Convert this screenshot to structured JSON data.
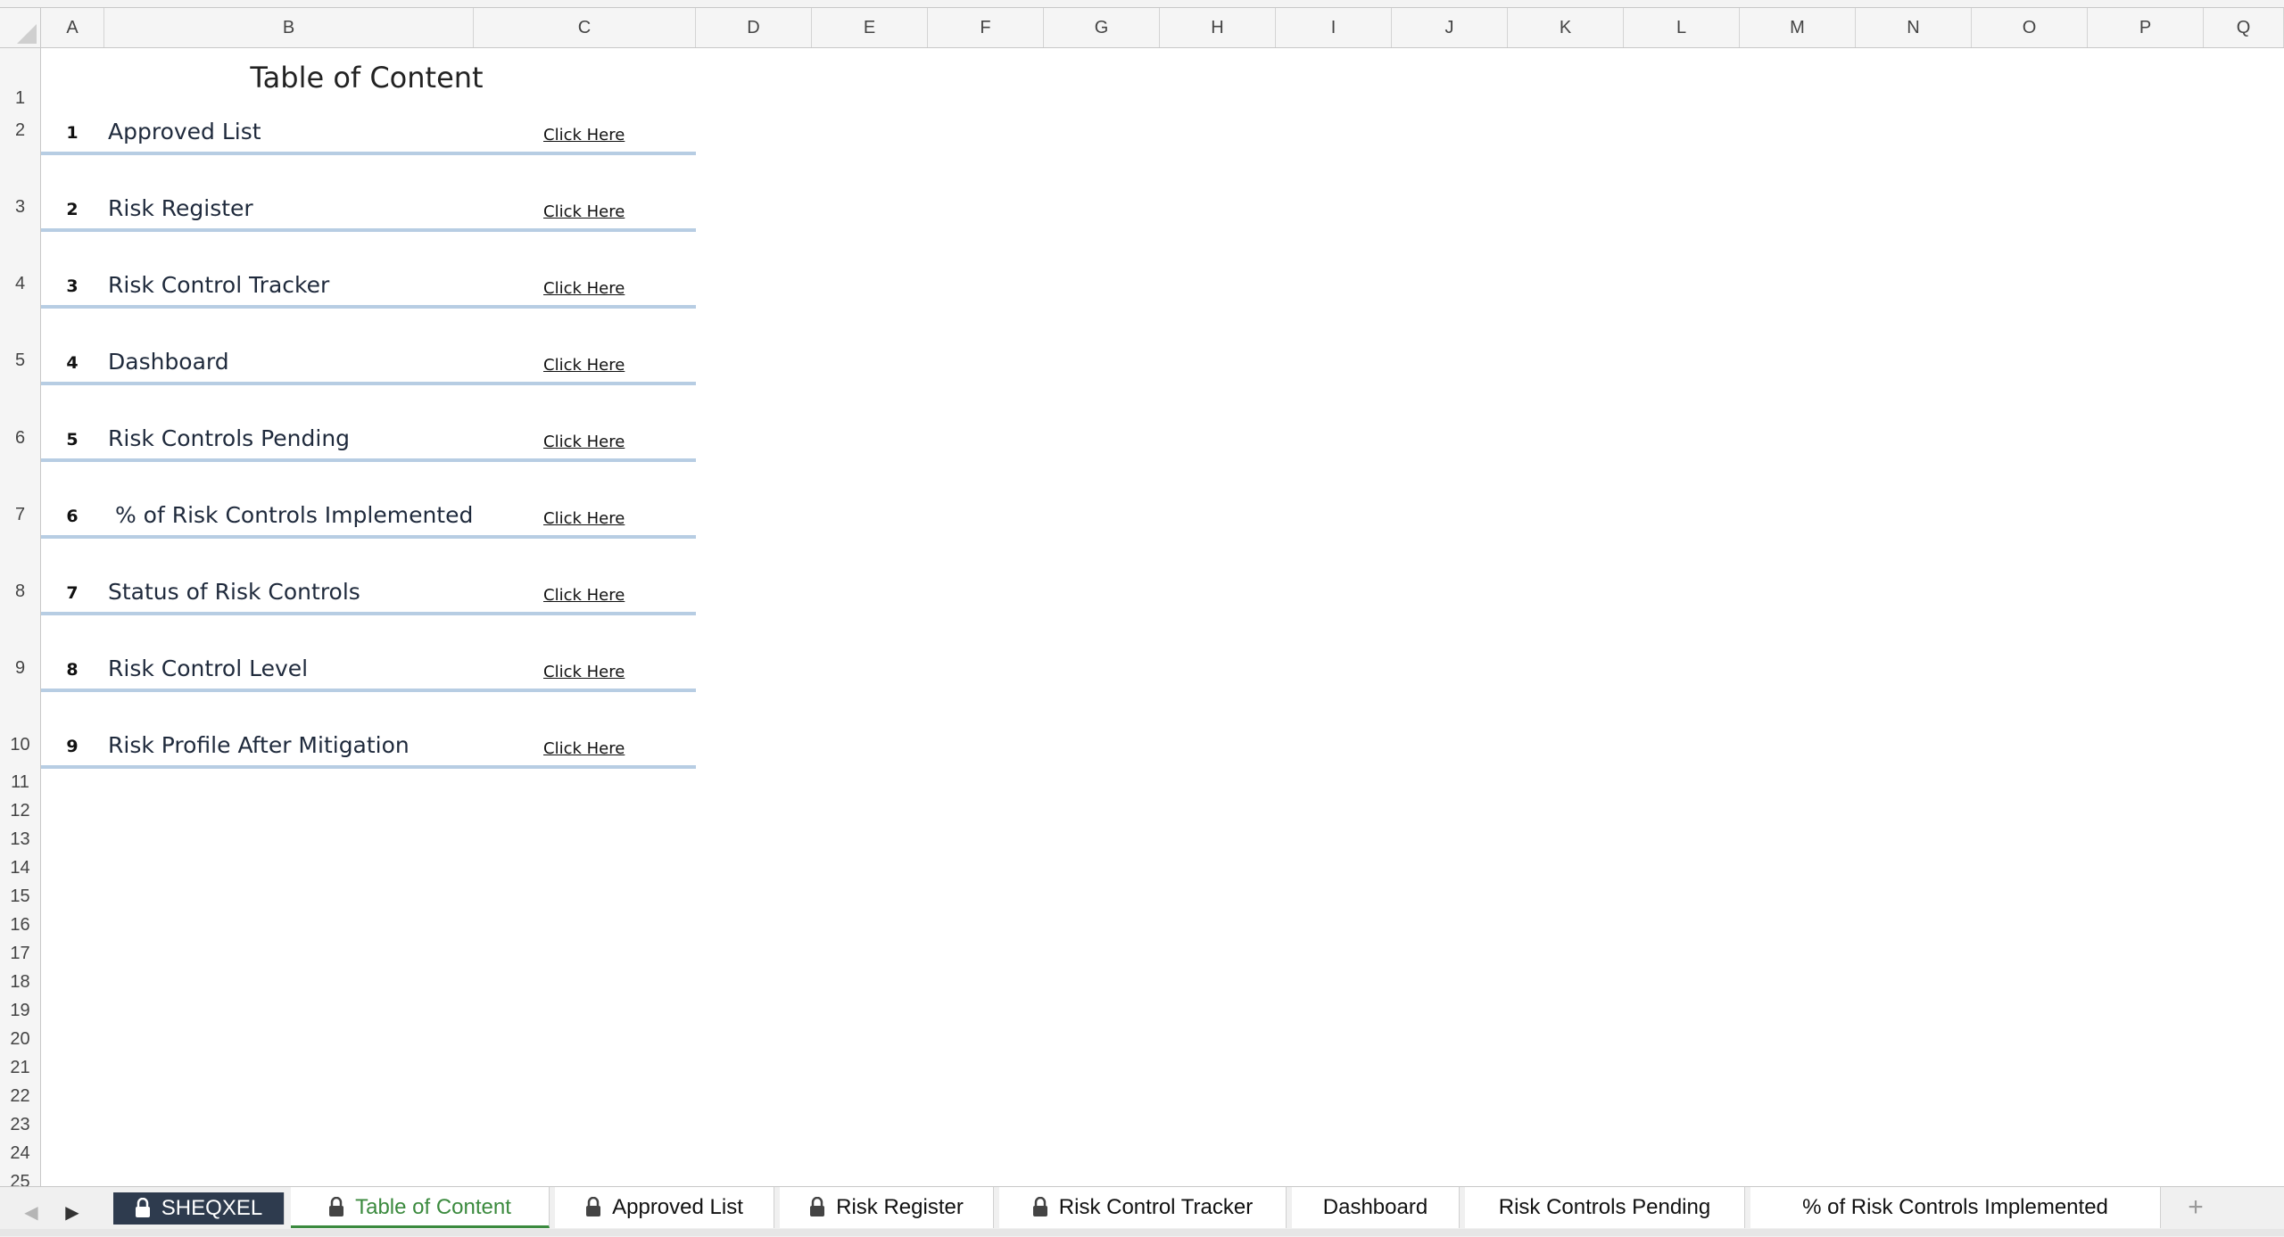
{
  "columns": [
    "A",
    "B",
    "C",
    "D",
    "E",
    "F",
    "G",
    "H",
    "I",
    "J",
    "K",
    "L",
    "M",
    "N",
    "O",
    "P",
    "Q"
  ],
  "rows": [
    "1",
    "2",
    "3",
    "4",
    "5",
    "6",
    "7",
    "8",
    "9",
    "10",
    "11",
    "12",
    "13",
    "14",
    "15",
    "16",
    "17",
    "18",
    "19",
    "20",
    "21",
    "22",
    "23",
    "24",
    "25"
  ],
  "toc": {
    "title": "Table of Content",
    "link_label": "Click Here",
    "items": [
      {
        "num": "1",
        "label": "Approved List"
      },
      {
        "num": "2",
        "label": "Risk Register"
      },
      {
        "num": "3",
        "label": "Risk Control Tracker"
      },
      {
        "num": "4",
        "label": "Dashboard"
      },
      {
        "num": "5",
        "label": "Risk Controls Pending"
      },
      {
        "num": "6",
        "label": " % of Risk Controls Implemented"
      },
      {
        "num": "7",
        "label": "Status of Risk Controls"
      },
      {
        "num": "8",
        "label": "Risk Control Level"
      },
      {
        "num": "9",
        "label": "Risk Profile After Mitigation"
      }
    ]
  },
  "tabs": [
    {
      "label": "SHEQXEL",
      "locked": true
    },
    {
      "label": "Table of Content",
      "locked": true,
      "active": true
    },
    {
      "label": "Approved List",
      "locked": true
    },
    {
      "label": "Risk Register",
      "locked": true
    },
    {
      "label": "Risk Control Tracker",
      "locked": true
    },
    {
      "label": "Dashboard",
      "locked": false
    },
    {
      "label": "Risk Controls Pending",
      "locked": false
    },
    {
      "label": "% of Risk Controls Implemented",
      "locked": false
    }
  ],
  "icons": {
    "lock": "lock-icon",
    "prev": "chevron-left-icon",
    "next": "chevron-right-icon",
    "add": "plus-icon"
  },
  "colors": {
    "accent_green": "#3b8a3e",
    "brand_tab": "#2e3b4e",
    "row_border": "#b7cde3"
  }
}
